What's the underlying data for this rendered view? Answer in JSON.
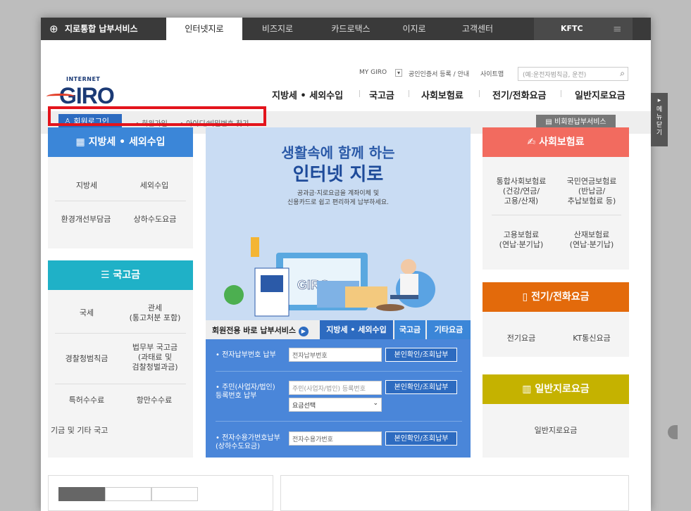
{
  "topnav": {
    "brand": "지로통합 납부서비스",
    "tabs": [
      "인터넷지로",
      "비즈지로",
      "카드로택스",
      "이지로",
      "고객센터"
    ],
    "kftc": "KFTC"
  },
  "logo": {
    "small": "INTERNET",
    "main": "GIRO"
  },
  "util": {
    "mygiro": "MY GIRO",
    "cert": "공인인증서 등록 / 안내",
    "sitemap": "사이트맵"
  },
  "search": {
    "placeholder": "(예:운전자범칙금, 운전)"
  },
  "mainnav": [
    "지방세 • 세외수입",
    "국고금",
    "사회보험료",
    "전기/전화요금",
    "일반지로요금"
  ],
  "loginbar": {
    "login": "회원로그인",
    "join": "회원가입",
    "find": "아이디/비밀번호 찾기",
    "biz": "비회원납부서비스"
  },
  "local": {
    "title": "지방세 • 세외수입",
    "items": [
      "지방세",
      "세외수입",
      "환경개선부담금",
      "상하수도요금"
    ]
  },
  "national": {
    "title": "국고금",
    "items": [
      "국세",
      "관세\n(통고처분 포함)",
      "경찰청범칙금",
      "법무부 국고금\n(과태료 및\n검찰청벌과금)",
      "특허수수료",
      "항만수수료",
      "기금 및 기타 국고"
    ]
  },
  "banner": {
    "line1": "생활속에 함께 하는",
    "line2": "인터넷 지로",
    "line3": "공과금·지로요금을 계좌이체 및\n신용카드로 쉽고 편리하게 납부하세요."
  },
  "svc": {
    "title": "회원전용 바로 납부서비스",
    "tabs": [
      "지방세 • 세외수입",
      "국고금",
      "기타요금"
    ]
  },
  "form": {
    "r1_label": "• 전자납부번호 납부",
    "r1_placeholder": "전자납부번호",
    "r1_btn": "본인확인/조회납부",
    "r2_label": "• 주민(사업자/법인)\n  등록번호 납부",
    "r2_placeholder": "주민(사업자/법인) 등록번호",
    "r2_btn": "본인확인/조회납부",
    "r2_select": "요금선택",
    "r3_label": "• 전자수용가번호납부\n  (상하수도요금)",
    "r3_placeholder": "전자수용가번호",
    "r3_btn": "본인확인/조회납부"
  },
  "social": {
    "title": "사회보험료",
    "items": [
      "통합사회보험료\n(건강/연금/\n고용/산재)",
      "국민연금보험료\n(반납금/\n추납보험료 등)",
      "고용보험료\n(연납·분기납)",
      "산재보험료\n(연납·분기납)"
    ]
  },
  "elec": {
    "title": "전기/전화요금",
    "items": [
      "전기요금",
      "KT통신요금"
    ]
  },
  "general": {
    "title": "일반지로요금",
    "items": [
      "일반지로요금"
    ]
  },
  "side": {
    "label": "메뉴닫기"
  }
}
